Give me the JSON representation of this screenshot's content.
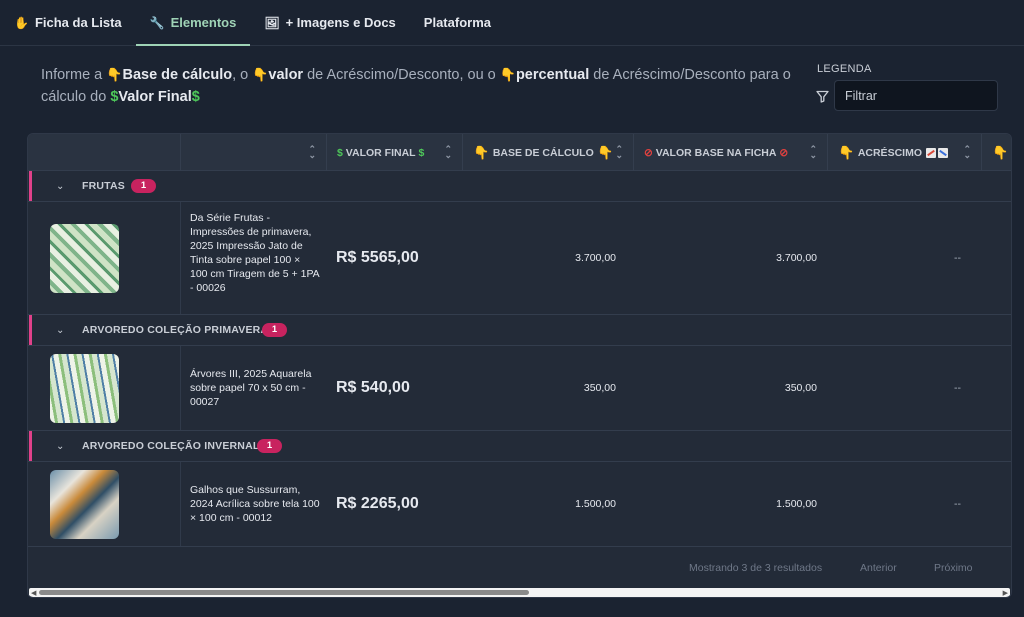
{
  "tabs": [
    {
      "label": "Ficha da Lista",
      "icon": "hand-icon",
      "active": false
    },
    {
      "label": "Elementos",
      "icon": "wrench-icon",
      "active": true
    },
    {
      "label": "+ Imagens e Docs",
      "icon": "image-icon",
      "active": false
    },
    {
      "label": "Plataforma",
      "icon": "",
      "active": false
    }
  ],
  "info": {
    "t1": "Informe a ",
    "b1": "Base de cálculo",
    "t2": ", o ",
    "b2": "valor",
    "t3": " de Acréscimo/Desconto, ou o ",
    "b3": "percentual",
    "t4": " de Acréscimo/Desconto para o cálculo do ",
    "b4": "Valor Final"
  },
  "legend": {
    "label": "LEGENDA",
    "filter_placeholder": "Filtrar"
  },
  "columns": [
    {
      "label": ""
    },
    {
      "label": ""
    },
    {
      "label": "VALOR FINAL"
    },
    {
      "label": "BASE DE CÁLCULO"
    },
    {
      "label": "VALOR BASE NA FICHA"
    },
    {
      "label": "ACRÉSCIMO"
    },
    {
      "label": ""
    }
  ],
  "groups": [
    {
      "name": "FRUTAS",
      "count": "1",
      "item": {
        "description": "Da Série Frutas - Impressões de primavera, 2025 Impressão Jato de Tinta sobre papel 100 × 100 cm Tiragem de 5 + 1PA - 00026",
        "valor_final": "R$ 5565,00",
        "base_calculo": "3.700,00",
        "valor_base_ficha": "3.700,00",
        "acrescimo": "--"
      }
    },
    {
      "name": "ARVOREDO COLEÇÃO PRIMAVERA",
      "count": "1",
      "item": {
        "description": "Árvores III, 2025 Aquarela sobre papel 70 x 50 cm - 00027",
        "valor_final": "R$ 540,00",
        "base_calculo": "350,00",
        "valor_base_ficha": "350,00",
        "acrescimo": "--"
      }
    },
    {
      "name": "ARVOREDO COLEÇÃO INVERNAL",
      "count": "1",
      "item": {
        "description": "Galhos que Sussurram, 2024 Acrílica sobre tela 100 × 100 cm - 00012",
        "valor_final": "R$ 2265,00",
        "base_calculo": "1.500,00",
        "valor_base_ficha": "1.500,00",
        "acrescimo": "--"
      }
    }
  ],
  "footer": {
    "results": "Mostrando 3 de 3 resultados",
    "prev": "Anterior",
    "next": "Próximo"
  },
  "colors": {
    "accent": "#9fd3b6",
    "badge": "#c8235f",
    "group_bar": "#e0418a",
    "money": "#4ec75a"
  }
}
